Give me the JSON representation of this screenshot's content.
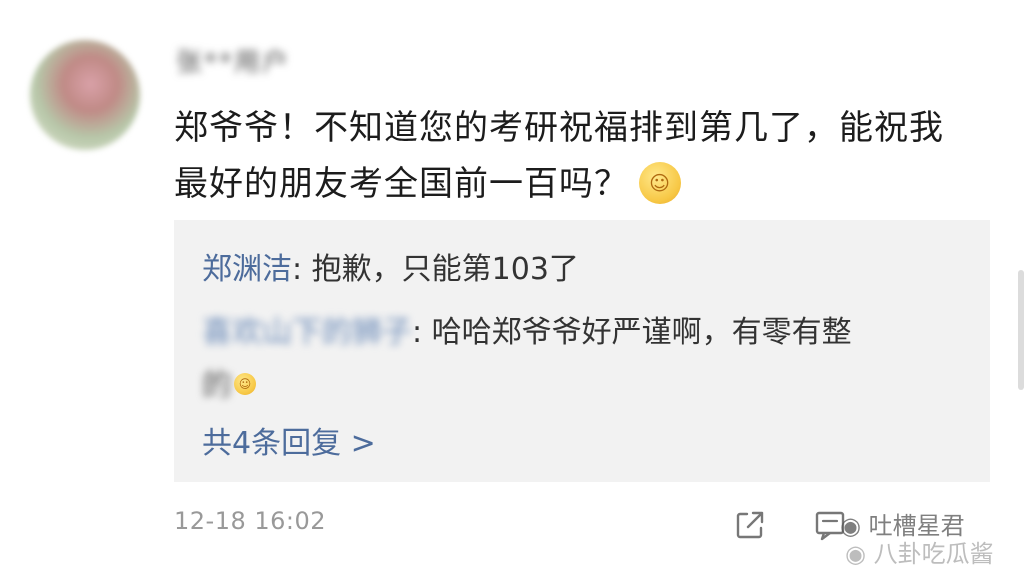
{
  "comment": {
    "username": "张**用户",
    "text": "郑爷爷！不知道您的考研祝福排到第几了，能祝我最好的朋友考全国前一百吗？",
    "emoji": "smirk-emoji",
    "timestamp": "12-18 16:02"
  },
  "replies": [
    {
      "name": "郑渊洁",
      "separator": ": ",
      "text": "抱歉，只能第103了"
    },
    {
      "name": "喜欢山下的狮子",
      "separator": ": ",
      "text": "哈哈郑爷爷好严谨啊，有零有整",
      "text_tail": "的"
    }
  ],
  "more_replies_label": "共4条回复 >",
  "icons": {
    "share": "share-icon",
    "comment": "comment-icon"
  },
  "watermark": {
    "line1": "吐槽星君",
    "line2": "八卦吃瓜酱"
  },
  "colors": {
    "link_blue": "#4d6c9c",
    "reply_bg": "#f2f2f2",
    "timestamp_gray": "#999999"
  }
}
